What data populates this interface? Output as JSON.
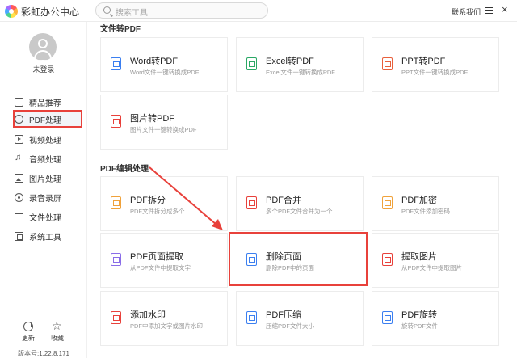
{
  "app": {
    "title": "彩虹办公中心"
  },
  "search": {
    "placeholder": "搜索工具"
  },
  "header": {
    "contact": "联系我们"
  },
  "user": {
    "name": "未登录"
  },
  "sidebar": {
    "items": [
      {
        "label": "精品推荐",
        "icon": "thumb-up-icon",
        "active": false
      },
      {
        "label": "PDF处理",
        "icon": "pdf-icon",
        "active": true
      },
      {
        "label": "视频处理",
        "icon": "video-icon",
        "active": false
      },
      {
        "label": "音频处理",
        "icon": "music-icon",
        "active": false
      },
      {
        "label": "图片处理",
        "icon": "image-icon",
        "active": false
      },
      {
        "label": "录音录屏",
        "icon": "record-icon",
        "active": false
      },
      {
        "label": "文件处理",
        "icon": "folder-icon",
        "active": false
      },
      {
        "label": "系统工具",
        "icon": "tools-icon",
        "active": false
      }
    ],
    "update_label": "更新",
    "favorite_label": "收藏",
    "version": "版本号:1.22.8.171"
  },
  "sections": {
    "convert": {
      "title": "文件转PDF",
      "tools": [
        {
          "title": "Word转PDF",
          "desc": "Word文件一键转换成PDF",
          "color": "#3b7ff0"
        },
        {
          "title": "Excel转PDF",
          "desc": "Excel文件一键转换成PDF",
          "color": "#2aa865"
        },
        {
          "title": "PPT转PDF",
          "desc": "PPT文件一键转换成PDF",
          "color": "#e8603c"
        },
        {
          "title": "图片转PDF",
          "desc": "图片文件一键转换成PDF",
          "color": "#e8413b"
        }
      ]
    },
    "edit": {
      "title": "PDF编辑处理",
      "tools": [
        {
          "title": "PDF拆分",
          "desc": "PDF文件拆分成多个",
          "color": "#f0a23b"
        },
        {
          "title": "PDF合并",
          "desc": "多个PDF文件合并为一个",
          "color": "#e8413b"
        },
        {
          "title": "PDF加密",
          "desc": "PDF文件添加密码",
          "color": "#f0a23b"
        },
        {
          "title": "PDF页面提取",
          "desc": "从PDF文件中提取文字",
          "color": "#8a6de8"
        },
        {
          "title": "删除页面",
          "desc": "删除PDF中的页面",
          "color": "#3b7ff0"
        },
        {
          "title": "提取图片",
          "desc": "从PDF文件中提取图片",
          "color": "#e8413b"
        },
        {
          "title": "添加水印",
          "desc": "PDF中添加文字或图片水印",
          "color": "#e8413b"
        },
        {
          "title": "PDF压缩",
          "desc": "压缩PDF文件大小",
          "color": "#3b7ff0"
        },
        {
          "title": "PDF旋转",
          "desc": "旋转PDF文件",
          "color": "#3b7ff0"
        }
      ]
    }
  },
  "colors": {
    "accent_red": "#e8413b",
    "active_bg": "#f2f4f8"
  }
}
